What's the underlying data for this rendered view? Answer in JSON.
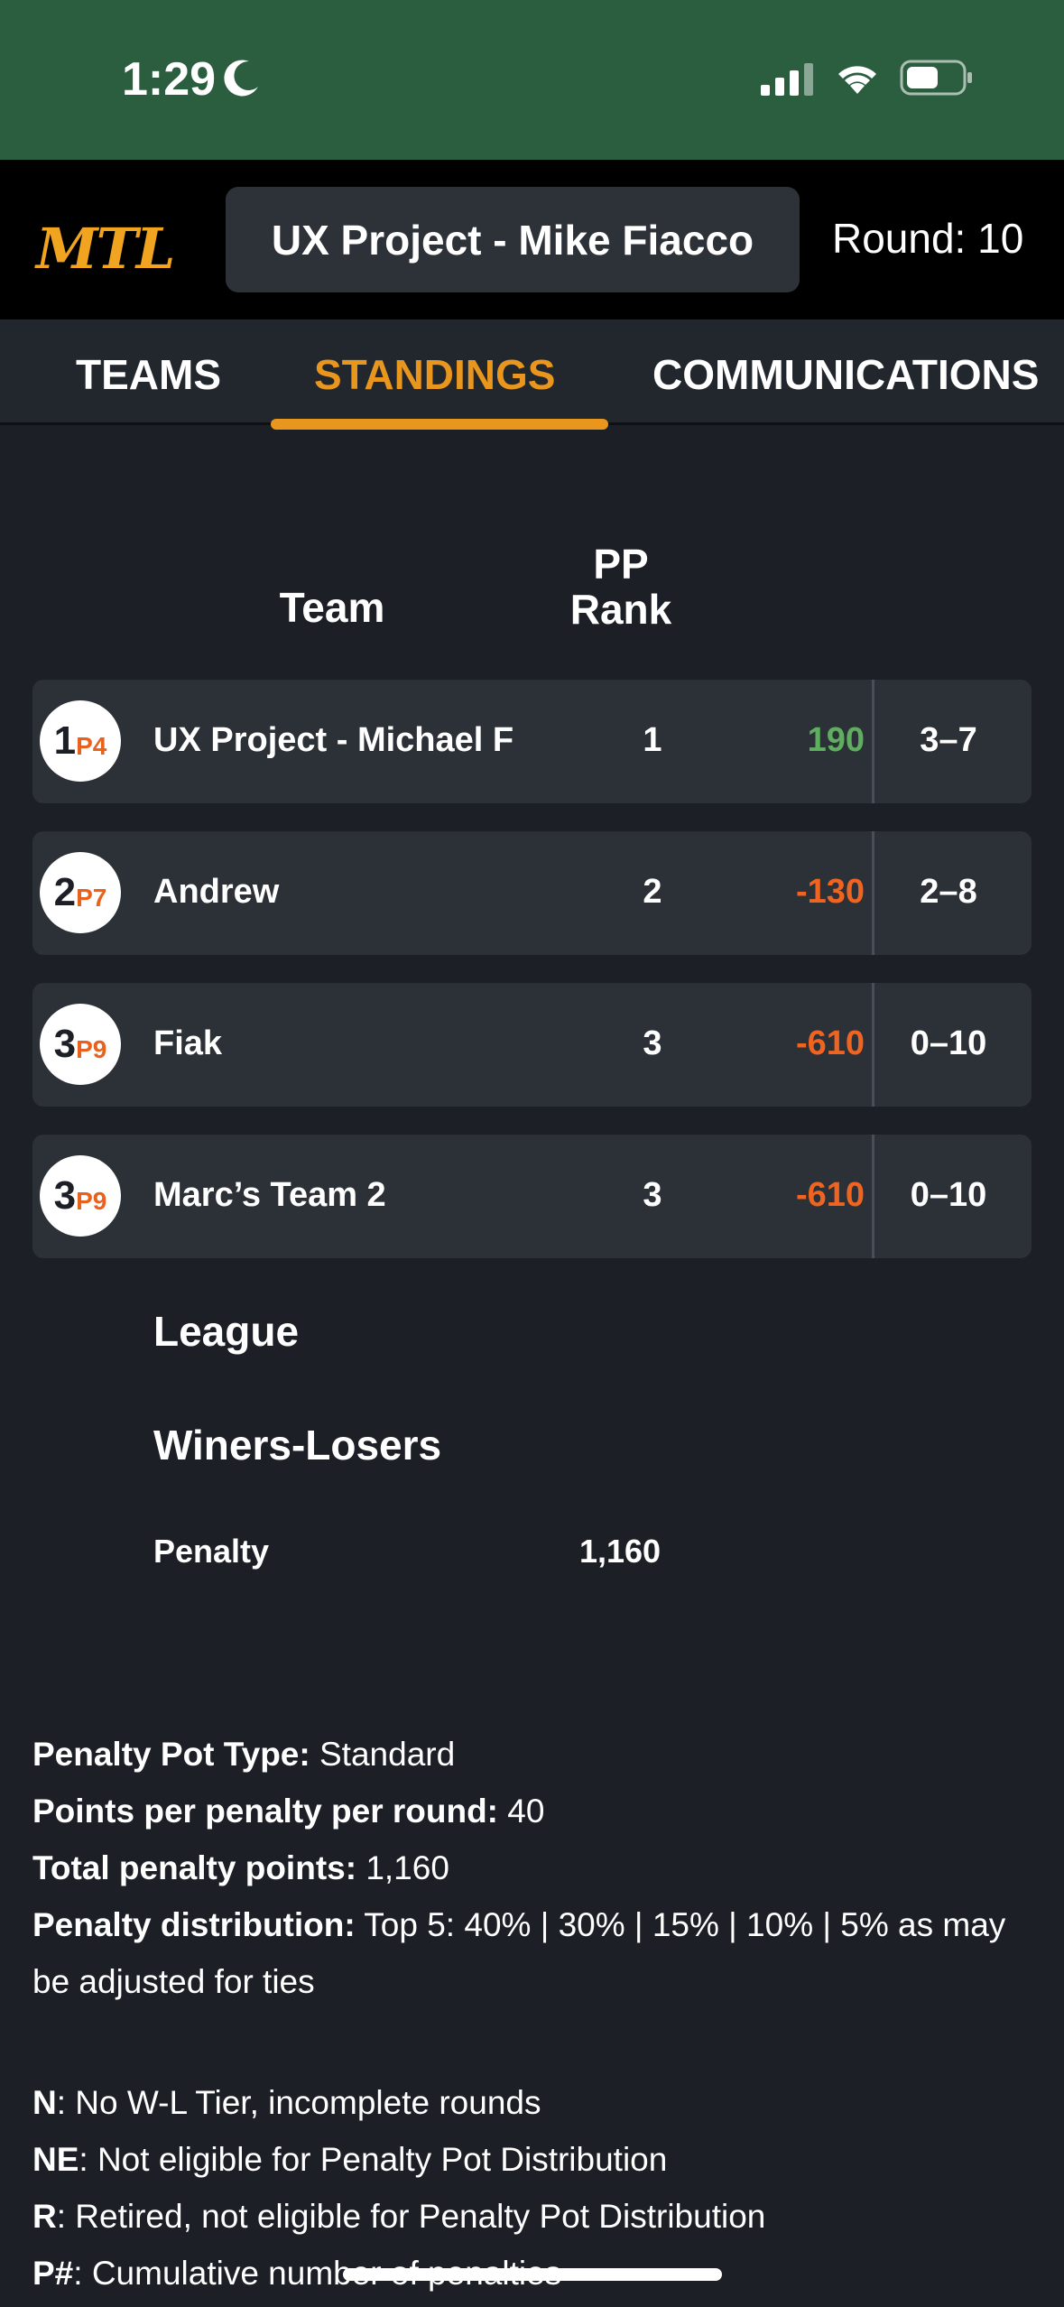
{
  "status_bar": {
    "time": "1:29",
    "color": "#2b5e3f"
  },
  "header": {
    "logo": "MTL",
    "team_select": "UX Project - Mike Fiacco",
    "round": "Round: 10"
  },
  "tabs": [
    {
      "label": "TEAMS",
      "active": false
    },
    {
      "label": "STANDINGS",
      "active": true
    },
    {
      "label": "COMMUNICATIONS",
      "active": false
    }
  ],
  "table": {
    "headers": {
      "team": "Team",
      "pp_rank_line1": "PP",
      "pp_rank_line2": "Rank"
    },
    "rows": [
      {
        "rank": "1",
        "penalties": "P4",
        "name": "UX Project - Michael F",
        "pp_rank": "1",
        "points": "190",
        "wl": "3–7",
        "sign": "pos"
      },
      {
        "rank": "2",
        "penalties": "P7",
        "name": "Andrew",
        "pp_rank": "2",
        "points": "-130",
        "wl": "2–8",
        "sign": "neg"
      },
      {
        "rank": "3",
        "penalties": "P9",
        "name": "Fiak",
        "pp_rank": "3",
        "points": "-610",
        "wl": "0–10",
        "sign": "neg"
      },
      {
        "rank": "3",
        "penalties": "P9",
        "name": "Marc’s Team 2",
        "pp_rank": "3",
        "points": "-610",
        "wl": "0–10",
        "sign": "neg"
      }
    ]
  },
  "league": {
    "title": "League",
    "subtitle": "Winers-Losers",
    "penalty_label": "Penalty",
    "penalty_value": "1,160"
  },
  "info": {
    "pot_type_label": "Penalty Pot Type:",
    "pot_type_value": " Standard",
    "points_per_label": "Points per penalty per round:",
    "points_per_value": " 40",
    "total_label": "Total penalty points:",
    "total_value": " 1,160",
    "distribution_label": "Penalty distribution:",
    "distribution_value": " Top 5: 40% | 30% | 15% | 10% | 5% as may be adjusted for ties"
  },
  "legend": [
    {
      "key": "N",
      "text": ": No W-L Tier, incomplete rounds"
    },
    {
      "key": "NE",
      "text": ": Not eligible for Penalty Pot Distribution"
    },
    {
      "key": "R",
      "text": ": Retired, not eligible for Penalty Pot Distribution"
    },
    {
      "key": "P#",
      "text": ": Cumulative number of penalties"
    }
  ],
  "colors": {
    "accent": "#e8961e",
    "positive": "#5fae5f",
    "negative": "#ef6420",
    "background": "#1c1f26"
  }
}
